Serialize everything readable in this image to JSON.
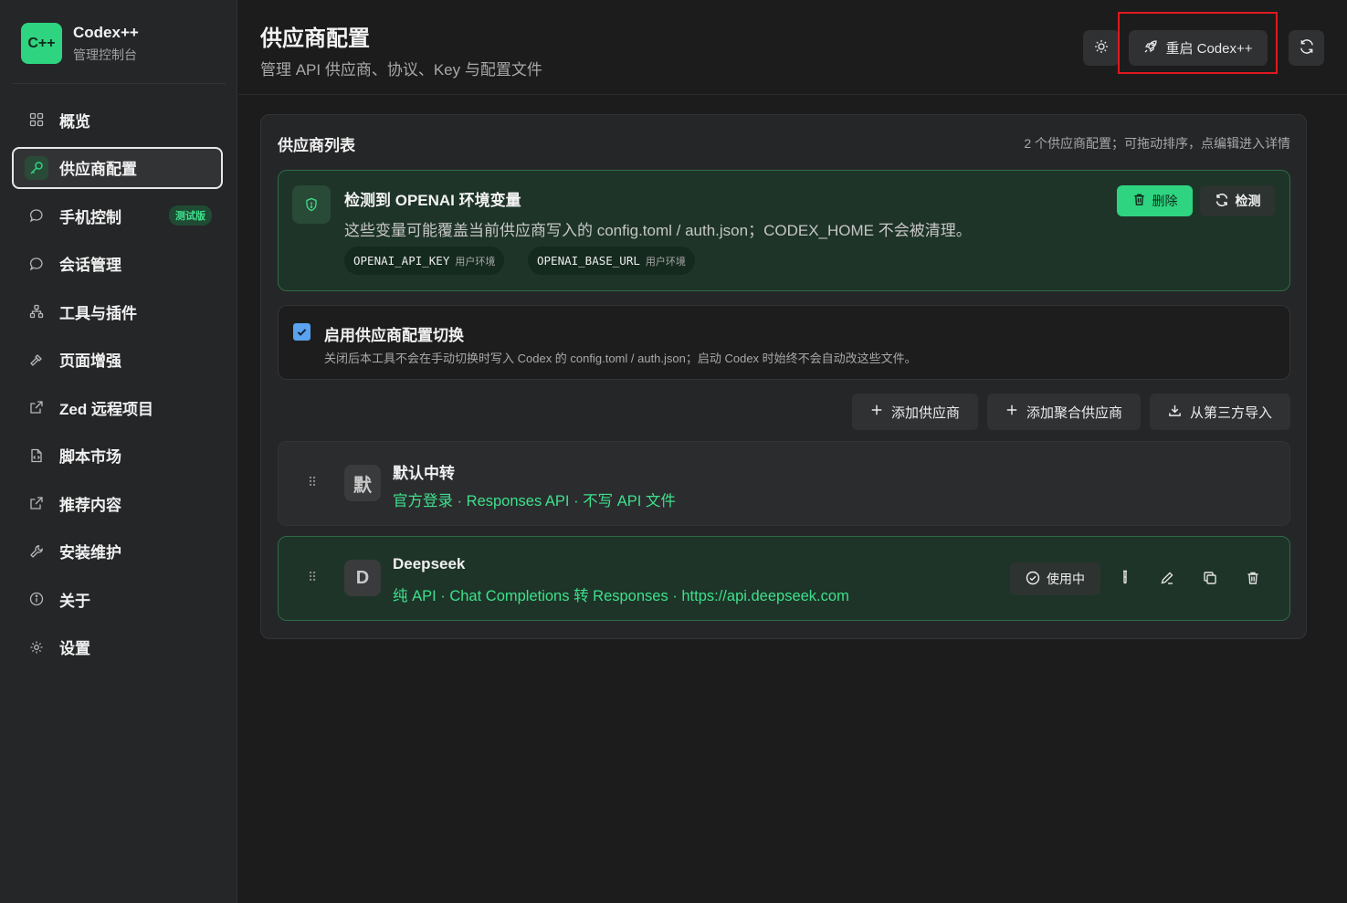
{
  "brand": {
    "logo": "C++",
    "title": "Codex++",
    "subtitle": "管理控制台"
  },
  "nav": [
    {
      "label": "概览",
      "icon": "grid-icon"
    },
    {
      "label": "供应商配置",
      "icon": "key-icon",
      "active": true
    },
    {
      "label": "手机控制",
      "icon": "chat-bubble-icon",
      "badge": "测试版"
    },
    {
      "label": "会话管理",
      "icon": "chat-bubble-icon"
    },
    {
      "label": "工具与插件",
      "icon": "network-icon"
    },
    {
      "label": "页面增强",
      "icon": "hammer-icon"
    },
    {
      "label": "Zed 远程项目",
      "icon": "external-link-icon"
    },
    {
      "label": "脚本市场",
      "icon": "script-file-icon"
    },
    {
      "label": "推荐内容",
      "icon": "external-link-icon"
    },
    {
      "label": "安装维护",
      "icon": "wrench-icon"
    },
    {
      "label": "关于",
      "icon": "info-icon"
    },
    {
      "label": "设置",
      "icon": "gear-icon"
    }
  ],
  "header": {
    "title": "供应商配置",
    "subtitle": "管理 API 供应商、协议、Key 与配置文件",
    "restart_label": "重启 Codex++"
  },
  "panel": {
    "title": "供应商列表",
    "hint": "2 个供应商配置；可拖动排序，点编辑进入详情"
  },
  "env_notice": {
    "title": "检测到 OPENAI 环境变量",
    "description": "这些变量可能覆盖当前供应商写入的 config.toml / auth.json；CODEX_HOME 不会被清理。",
    "delete_label": "删除",
    "check_label": "检测",
    "vars": [
      {
        "key": "OPENAI_API_KEY",
        "tag": "用户环境"
      },
      {
        "key": "OPENAI_BASE_URL",
        "tag": "用户环境"
      }
    ]
  },
  "switch": {
    "checked": true,
    "title": "启用供应商配置切换",
    "description": "关闭后本工具不会在手动切换时写入 Codex 的 config.toml / auth.json；启动 Codex 时始终不会自动改这些文件。"
  },
  "actions": {
    "add_provider": "添加供应商",
    "add_aggregate": "添加聚合供应商",
    "import_third_party": "从第三方导入"
  },
  "providers": [
    {
      "avatar": "默",
      "name": "默认中转",
      "meta": "官方登录 · Responses API · 不写 API 文件",
      "in_use": false
    },
    {
      "avatar": "D",
      "name": "Deepseek",
      "meta": "纯 API · Chat Completions 转 Responses · https://api.deepseek.com",
      "in_use": true,
      "in_use_label": "使用中"
    }
  ],
  "colors": {
    "accent": "#2ed47f",
    "accent_text": "#3ee08c",
    "highlight_frame": "#e0191f"
  }
}
